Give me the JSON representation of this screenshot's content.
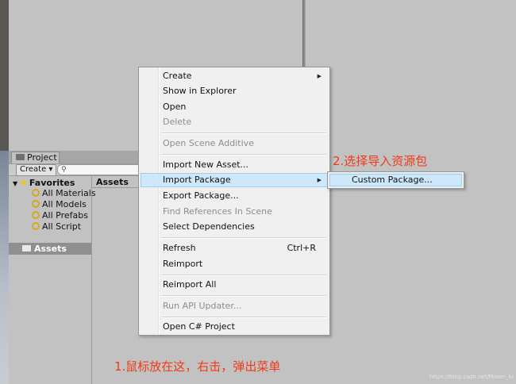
{
  "project_panel": {
    "tab_label": "Project",
    "create_label": "Create",
    "favorites_label": "Favorites",
    "favorites": [
      "All Materials",
      "All Models",
      "All Prefabs",
      "All Script"
    ],
    "assets_folder": "Assets",
    "breadcrumb": "Assets"
  },
  "context_menu": {
    "create": "Create",
    "show_in_explorer": "Show in Explorer",
    "open": "Open",
    "delete": "Delete",
    "open_scene_additive": "Open Scene Additive",
    "import_new_asset": "Import New Asset...",
    "import_package": "Import Package",
    "export_package": "Export Package...",
    "find_references": "Find References In Scene",
    "select_dependencies": "Select Dependencies",
    "refresh": "Refresh",
    "refresh_shortcut": "Ctrl+R",
    "reimport": "Reimport",
    "reimport_all": "Reimport All",
    "run_api_updater": "Run API Updater...",
    "open_csharp_project": "Open C# Project"
  },
  "submenu": {
    "custom_package": "Custom Package..."
  },
  "annotations": {
    "step2": "2.选择导入资源包",
    "step1": "1.鼠标放在这，右击，弹出菜单"
  },
  "watermark": "https://blog.csdn.net/Maker_lu",
  "colors": {
    "annotation": "#f03a17",
    "menu_highlight": "#cde8fb",
    "panel_bg": "#c2c2c2"
  }
}
